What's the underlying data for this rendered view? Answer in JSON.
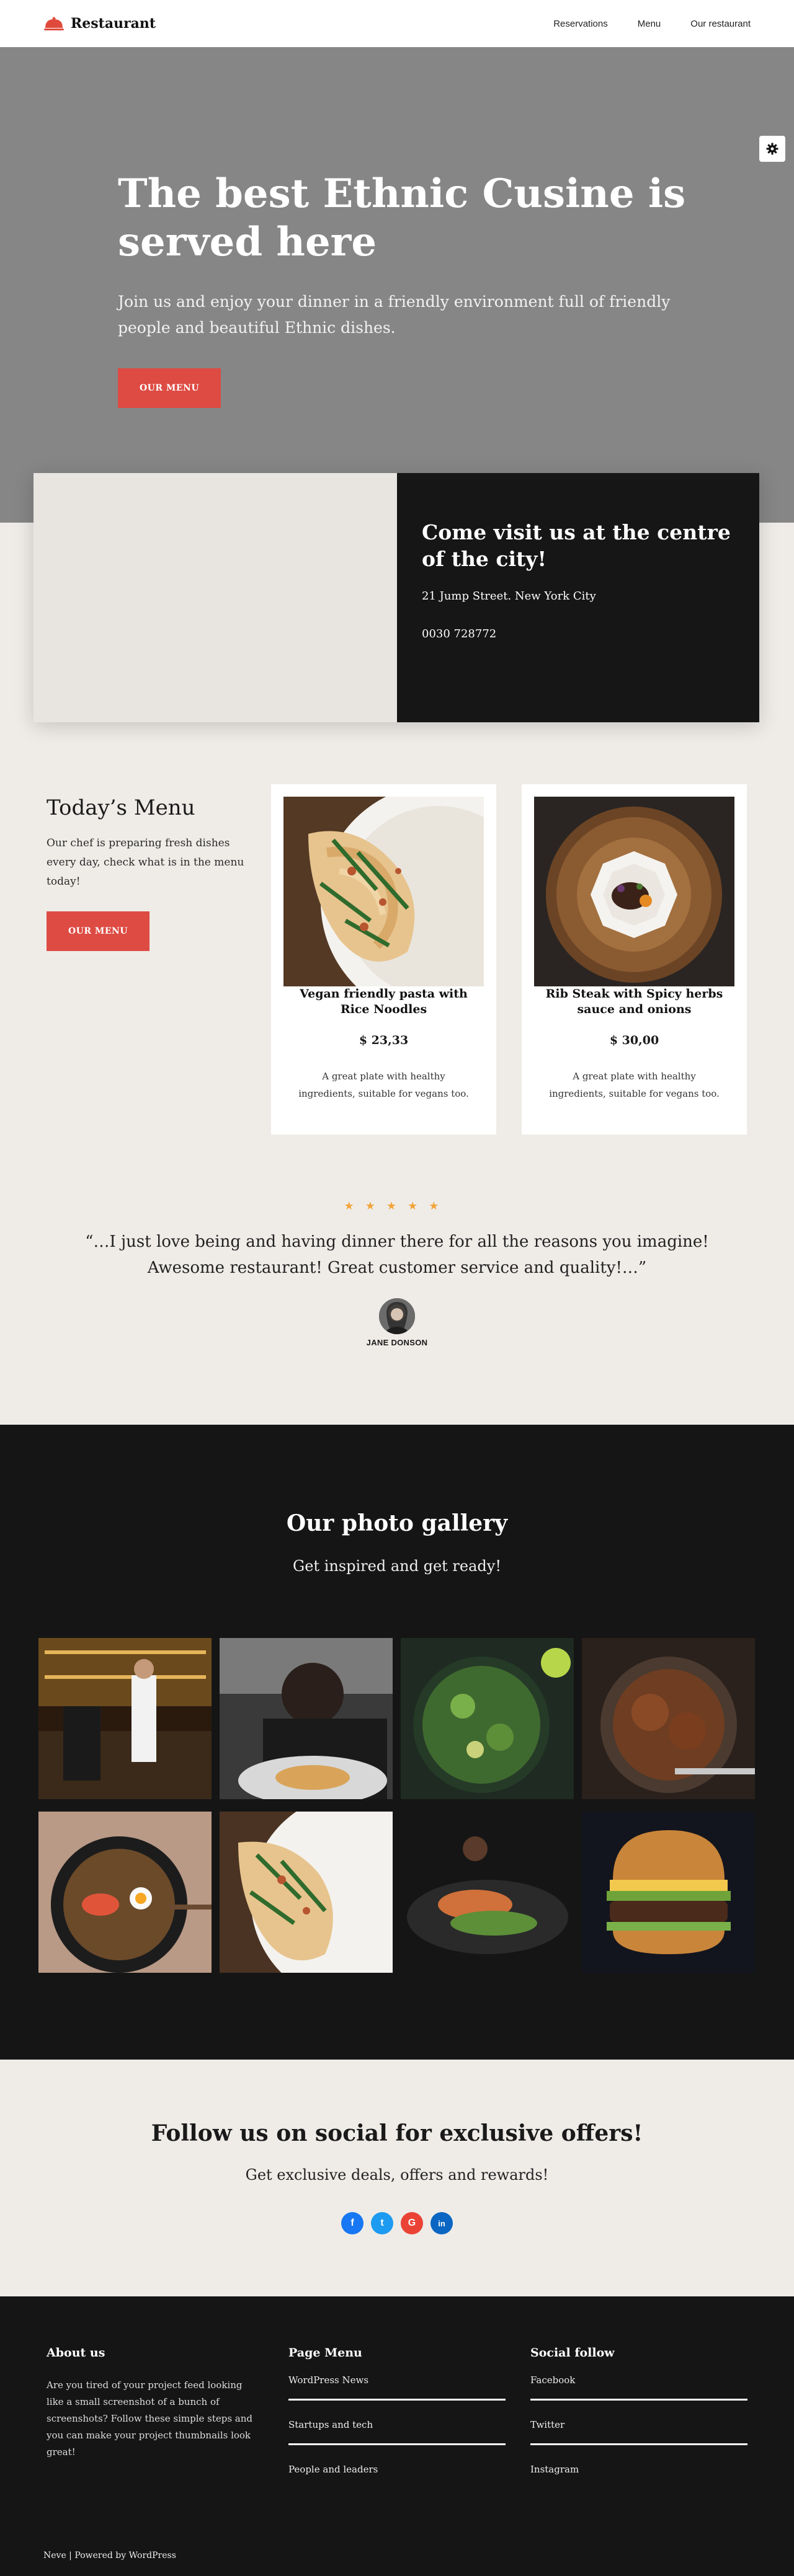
{
  "header": {
    "logo_text": "Restaurant",
    "nav": [
      "Reservations",
      "Menu",
      "Our restaurant"
    ]
  },
  "hero": {
    "title": "The best Ethnic Cusine is served here",
    "subtitle": "Join us and enjoy your dinner in a friendly environment full of friendly people and beautiful Ethnic dishes.",
    "button": "OUR MENU",
    "settings_icon": "gear-icon"
  },
  "visit": {
    "title": "Come visit us at the centre of the city!",
    "address": "21 Jump Street. New York City",
    "phone": "0030 728772"
  },
  "menu": {
    "title": "Today’s Menu",
    "text": "Our chef is preparing fresh dishes every day, check what is in the menu today!",
    "button": "OUR MENU",
    "cards": [
      {
        "name": "Vegan friendly pasta with Rice Noodles",
        "price": "$ 23,33",
        "desc": "A great plate with healthy ingredients, suitable for vegans too."
      },
      {
        "name": "Rib Steak with Spicy herbs sauce and onions",
        "price": "$ 30,00",
        "desc": "A great plate with healthy ingredients, suitable for vegans too."
      }
    ]
  },
  "testimonial": {
    "rating": 5,
    "quote": "“…I just love being and having dinner there for all the reasons you imagine! Awesome restaurant! Great customer service and quality!…”",
    "name": "JANE DONSON"
  },
  "gallery": {
    "title": "Our photo gallery",
    "subtitle": "Get inspired and get ready!"
  },
  "social": {
    "title": "Follow us on social for exclusive offers!",
    "subtitle": "Get exclusive deals, offers and rewards!",
    "icons": [
      {
        "name": "facebook-icon",
        "glyph": "f",
        "color": "#1877f2"
      },
      {
        "name": "twitter-icon",
        "glyph": "t",
        "color": "#1d9bf0"
      },
      {
        "name": "google-icon",
        "glyph": "G",
        "color": "#ea4335"
      },
      {
        "name": "linkedin-icon",
        "glyph": "in",
        "color": "#0a66c2"
      }
    ]
  },
  "footer": {
    "about_title": "About us",
    "about_text": "Are you tired of your project feed looking like a small screenshot of a bunch of screenshots? Follow these simple steps and you can make your project thumbnails look great!",
    "menu_title": "Page Menu",
    "menu_links": [
      "WordPress News",
      "Startups and tech",
      "People and leaders"
    ],
    "social_title": "Social follow",
    "social_links": [
      "Facebook",
      "Twitter",
      "Instagram"
    ],
    "copyright": "Neve | Powered by WordPress"
  },
  "colors": {
    "accent": "#dd4b43",
    "dark": "#151515",
    "background": "#efece8",
    "hero_overlay": "#868686",
    "star": "#f1a53a"
  }
}
